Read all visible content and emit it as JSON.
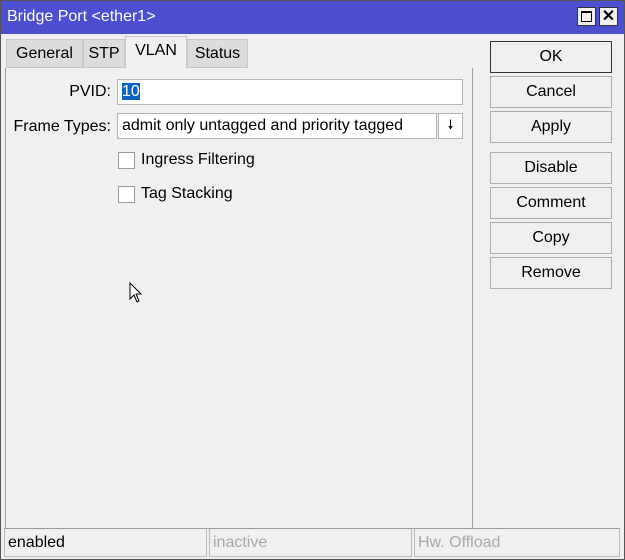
{
  "window": {
    "title": "Bridge Port <ether1>",
    "maximize_icon": "maximize-icon",
    "close_icon": "close-icon",
    "accent": "#4c4fcf"
  },
  "tabs": [
    {
      "label": "General"
    },
    {
      "label": "STP"
    },
    {
      "label": "VLAN",
      "active": true
    },
    {
      "label": "Status"
    }
  ],
  "form": {
    "pvid_label": "PVID:",
    "pvid_value": "10",
    "frame_types_label": "Frame Types:",
    "frame_types_value": "admit only untagged and priority tagged",
    "ingress_filtering_label": "Ingress Filtering",
    "ingress_filtering_checked": false,
    "tag_stacking_label": "Tag Stacking",
    "tag_stacking_checked": false
  },
  "buttons": {
    "ok": "OK",
    "cancel": "Cancel",
    "apply": "Apply",
    "disable": "Disable",
    "comment": "Comment",
    "copy": "Copy",
    "remove": "Remove"
  },
  "status": {
    "state": "enabled",
    "activity": "inactive",
    "offload": "Hw. Offload"
  }
}
